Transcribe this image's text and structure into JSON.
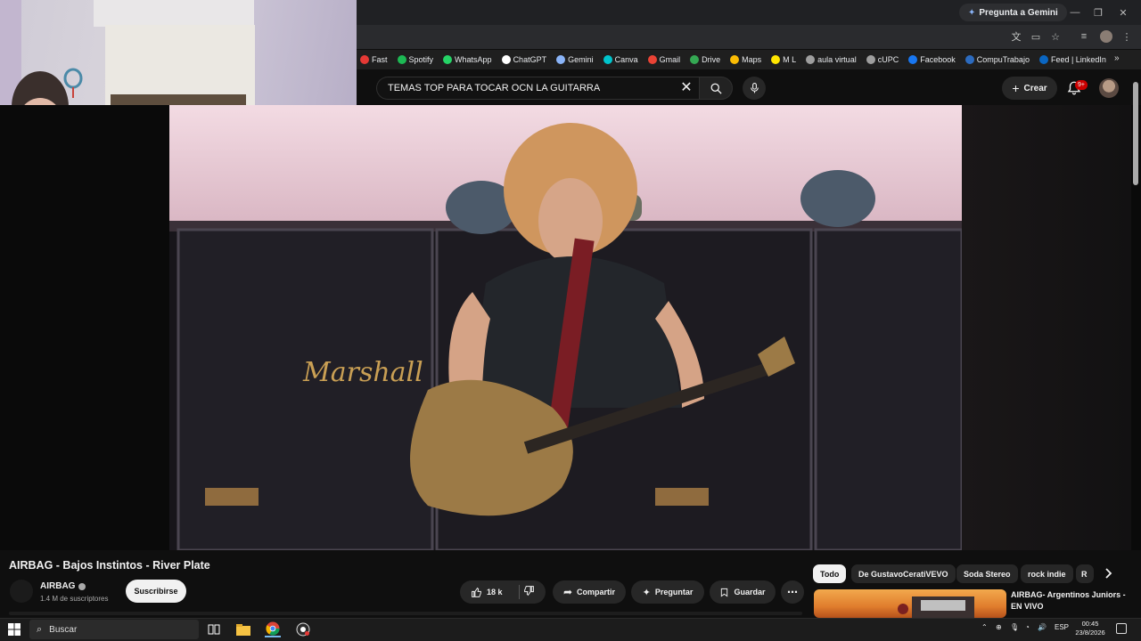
{
  "browser": {
    "gemini_button": "Pregunta a Gemini",
    "bookmarks": [
      {
        "label": "Fast",
        "color": "#e53935"
      },
      {
        "label": "Spotify",
        "color": "#1db954"
      },
      {
        "label": "WhatsApp",
        "color": "#25d366"
      },
      {
        "label": "ChatGPT",
        "color": "#ffffff"
      },
      {
        "label": "Gemini",
        "color": "#8ab4f8"
      },
      {
        "label": "Canva",
        "color": "#00c4cc"
      },
      {
        "label": "Gmail",
        "color": "#ea4335"
      },
      {
        "label": "Drive",
        "color": "#34a853"
      },
      {
        "label": "Maps",
        "color": "#fbbc04"
      },
      {
        "label": "M L",
        "color": "#ffe600"
      },
      {
        "label": "aula virtual",
        "color": "#9e9e9e"
      },
      {
        "label": "cUPC",
        "color": "#9e9e9e"
      },
      {
        "label": "Facebook",
        "color": "#1877f2"
      },
      {
        "label": "CompuTrabajo",
        "color": "#2c6bbf"
      },
      {
        "label": "Feed | LinkedIn",
        "color": "#0a66c2"
      }
    ]
  },
  "youtube": {
    "search_query": "TEMAS TOP PARA TOCAR OCN LA GUITARRA",
    "create_label": "Crear",
    "notification_count": "9+",
    "video": {
      "title": "AIRBAG - Bajos Instintos - River Plate",
      "channel": "AIRBAG",
      "subscribers": "1.4 M de suscriptores",
      "subscribe_label": "Suscribirse",
      "likes": "18 k",
      "share_label": "Compartir",
      "ask_label": "Preguntar",
      "save_label": "Guardar",
      "amp_brand": "Marshall"
    },
    "chips": [
      "Todo",
      "De GustavoCeratiVEVO",
      "Soda Stereo",
      "rock indie",
      "R"
    ],
    "recommendation": {
      "title": "AIRBAG- Argentinos Juniors - EN VIVO"
    }
  },
  "taskbar": {
    "search_placeholder": "Buscar",
    "language": "ESP",
    "time": "00:45",
    "date": "23/8/2026"
  }
}
